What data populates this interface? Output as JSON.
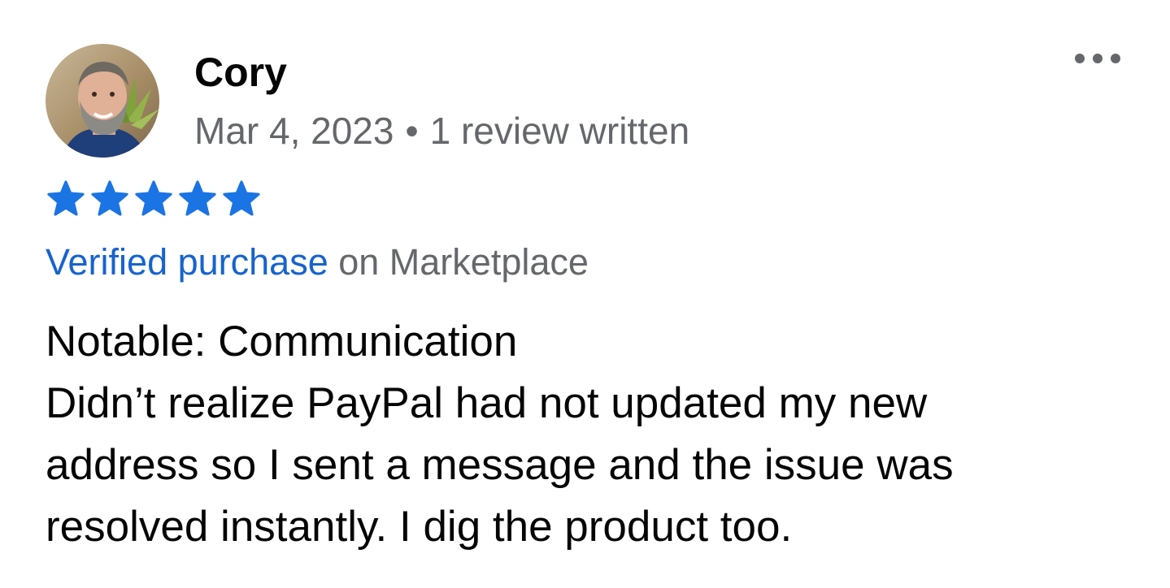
{
  "reviewer": {
    "name": "Cory",
    "date": "Mar 4, 2023",
    "separator": "•",
    "review_count": "1 review written"
  },
  "rating": {
    "stars": 5,
    "max": 5,
    "color": "#1b74e4"
  },
  "verification": {
    "link_text": "Verified purchase",
    "suffix": "on Marketplace",
    "link_color": "#1763cf"
  },
  "review": {
    "notable": "Notable: Communication",
    "body_lines": [
      "Didn’t realize PayPal had not updated my new",
      "address so I sent a message and the issue was",
      "resolved instantly. I dig the product too."
    ]
  },
  "icons": {
    "more": "more-options-icon",
    "star": "star-icon"
  }
}
